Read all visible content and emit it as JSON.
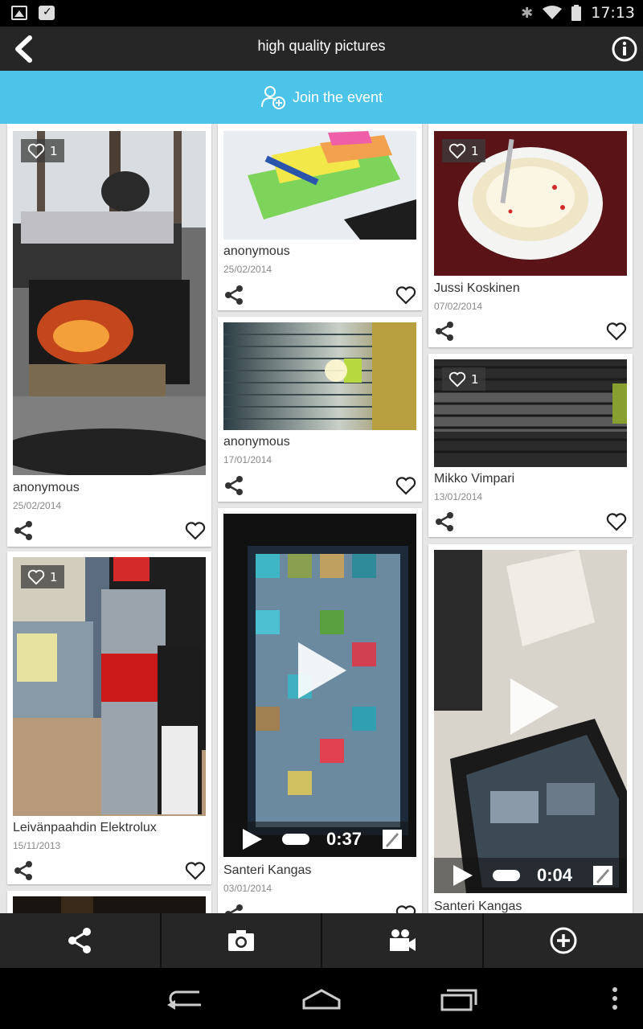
{
  "status_bar": {
    "time": "17:13",
    "icons": [
      "image-icon",
      "briefcase-check-icon",
      "bluetooth-icon",
      "wifi-icon",
      "battery-icon"
    ]
  },
  "header": {
    "title": "high quality pictures",
    "back_icon": "chevron-left-icon",
    "info_icon": "info-icon"
  },
  "join_bar": {
    "label": "Join the event",
    "icon": "user-add-icon",
    "color": "#4cc3e8"
  },
  "cards": [
    {
      "author": "anonymous",
      "date": "25/02/2014",
      "likes": "1",
      "type": "photo"
    },
    {
      "author": "Leivänpaahdin Elektrolux",
      "date": "15/11/2013",
      "likes": "1",
      "type": "photo"
    },
    {
      "author": "anonymous",
      "date": "25/02/2014",
      "likes": "",
      "type": "photo"
    },
    {
      "author": "anonymous",
      "date": "17/01/2014",
      "likes": "",
      "type": "photo"
    },
    {
      "author": "Santeri Kangas",
      "date": "03/01/2014",
      "likes": "",
      "type": "video",
      "duration": "0:37"
    },
    {
      "author": "Jussi Koskinen",
      "date": "07/02/2014",
      "likes": "1",
      "type": "photo"
    },
    {
      "author": "Mikko Vimpari",
      "date": "13/01/2014",
      "likes": "1",
      "type": "photo"
    },
    {
      "author": "Santeri Kangas",
      "date": "",
      "likes": "",
      "type": "video",
      "duration": "0:04"
    }
  ],
  "action_bar": {
    "buttons": [
      "share-icon",
      "camera-icon",
      "video-camera-icon",
      "add-circle-icon"
    ]
  },
  "nav_bar": {
    "buttons": [
      "back-icon",
      "home-icon",
      "recent-apps-icon",
      "overflow-menu-icon"
    ]
  }
}
